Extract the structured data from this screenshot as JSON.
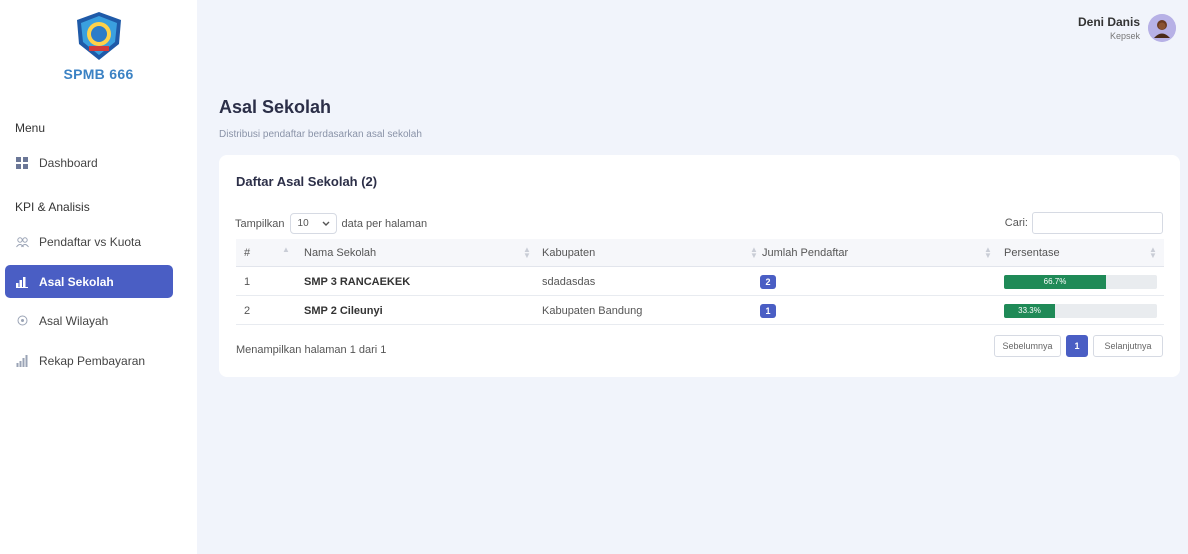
{
  "app": {
    "brand": "SPMB 666"
  },
  "user": {
    "name": "Deni Danis",
    "role": "Kepsek"
  },
  "sidebar": {
    "menu_heading": "Menu",
    "kpi_heading": "KPI & Analisis",
    "items": [
      {
        "label": "Dashboard",
        "icon": "grid-icon"
      },
      {
        "label": "Pendaftar vs Kuota",
        "icon": "users-icon"
      },
      {
        "label": "Asal Sekolah",
        "icon": "chart-bar-icon",
        "active": true
      },
      {
        "label": "Asal Wilayah",
        "icon": "map-pin-icon"
      },
      {
        "label": "Rekap Pembayaran",
        "icon": "chart-icon"
      }
    ]
  },
  "page": {
    "title": "Asal Sekolah",
    "subtitle": "Distribusi pendaftar berdasarkan asal sekolah"
  },
  "table_card": {
    "title": "Daftar Asal Sekolah (2)",
    "show_label": "Tampilkan",
    "page_size": "10",
    "per_page_label": "data per halaman",
    "search_label": "Cari:",
    "search_value": "",
    "columns": [
      "#",
      "Nama Sekolah",
      "Kabupaten",
      "Jumlah Pendaftar",
      "Persentase"
    ],
    "rows": [
      {
        "no": "1",
        "nama": "SMP 3 RANCAEKEK",
        "kabupaten": "sdadasdas",
        "jumlah": "2",
        "persen_label": "66.7%",
        "persen": 66.7
      },
      {
        "no": "2",
        "nama": "SMP 2 Cileunyi",
        "kabupaten": "Kabupaten Bandung",
        "jumlah": "1",
        "persen_label": "33.3%",
        "persen": 33.3
      }
    ],
    "info": "Menampilkan halaman 1 dari 1",
    "pager": {
      "prev": "Sebelumnya",
      "current": "1",
      "next": "Selanjutnya"
    }
  },
  "colors": {
    "accent": "#4a5ec4",
    "progress": "#1f8a57",
    "brand": "#3b82c4"
  }
}
